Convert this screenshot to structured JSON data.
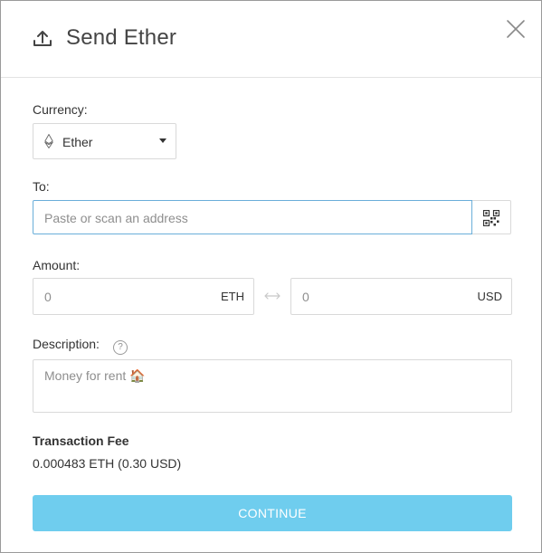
{
  "dialog": {
    "title": "Send Ether",
    "icon": "upload-icon",
    "close_icon": "close-icon"
  },
  "currency": {
    "label": "Currency:",
    "selected": "Ether",
    "icon": "ethereum-icon"
  },
  "to": {
    "label": "To:",
    "placeholder": "Paste or scan an address",
    "value": "",
    "qr_icon": "qr-code-icon"
  },
  "amount": {
    "label": "Amount:",
    "eth_value": "0",
    "eth_unit": "ETH",
    "usd_value": "0",
    "usd_unit": "USD",
    "swap_icon": "swap-arrows-icon"
  },
  "description": {
    "label": "Description:",
    "help_glyph": "?",
    "placeholder": "Money for rent 🏠",
    "value": ""
  },
  "fee": {
    "label": "Transaction Fee",
    "value": "0.000483 ETH (0.30 USD)"
  },
  "actions": {
    "continue_label": "CONTINUE"
  },
  "colors": {
    "accent": "#6fcdee",
    "focus_border": "#6aaed9",
    "text": "#333333",
    "placeholder": "#8e8e8e"
  }
}
